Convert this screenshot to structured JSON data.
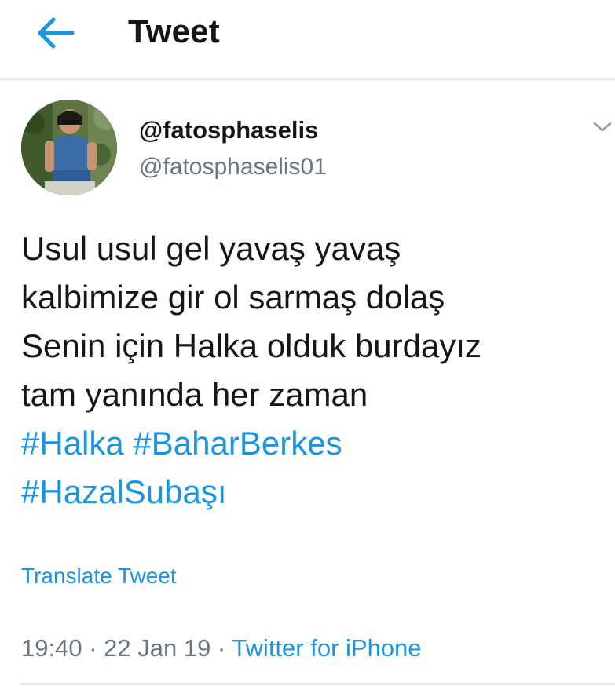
{
  "header": {
    "title": "Tweet",
    "back_icon": "arrow-left-icon",
    "accent_color": "#1b95e0"
  },
  "tweet": {
    "author": {
      "display_name": "@fatosphaselis",
      "handle": "@fatosphaselis01",
      "avatar": "avatar-photo"
    },
    "menu_icon": "chevron-down-icon",
    "text_lines": [
      "Usul usul gel yavaş yavaş",
      "kalbimize gir ol sarmaş dolaş",
      "Senin için Halka olduk burdayız",
      "tam yanında her zaman"
    ],
    "hashtags": [
      "#Halka",
      "#BaharBerkes",
      "#HazalSubaşı"
    ],
    "translate_label": "Translate Tweet",
    "time": "19:40",
    "separator": " · ",
    "date": "22 Jan 19",
    "source": "Twitter for iPhone"
  },
  "colors": {
    "text": "#14171a",
    "secondary": "#657786",
    "link": "#1b95e0",
    "divider": "#e1e8ed"
  }
}
